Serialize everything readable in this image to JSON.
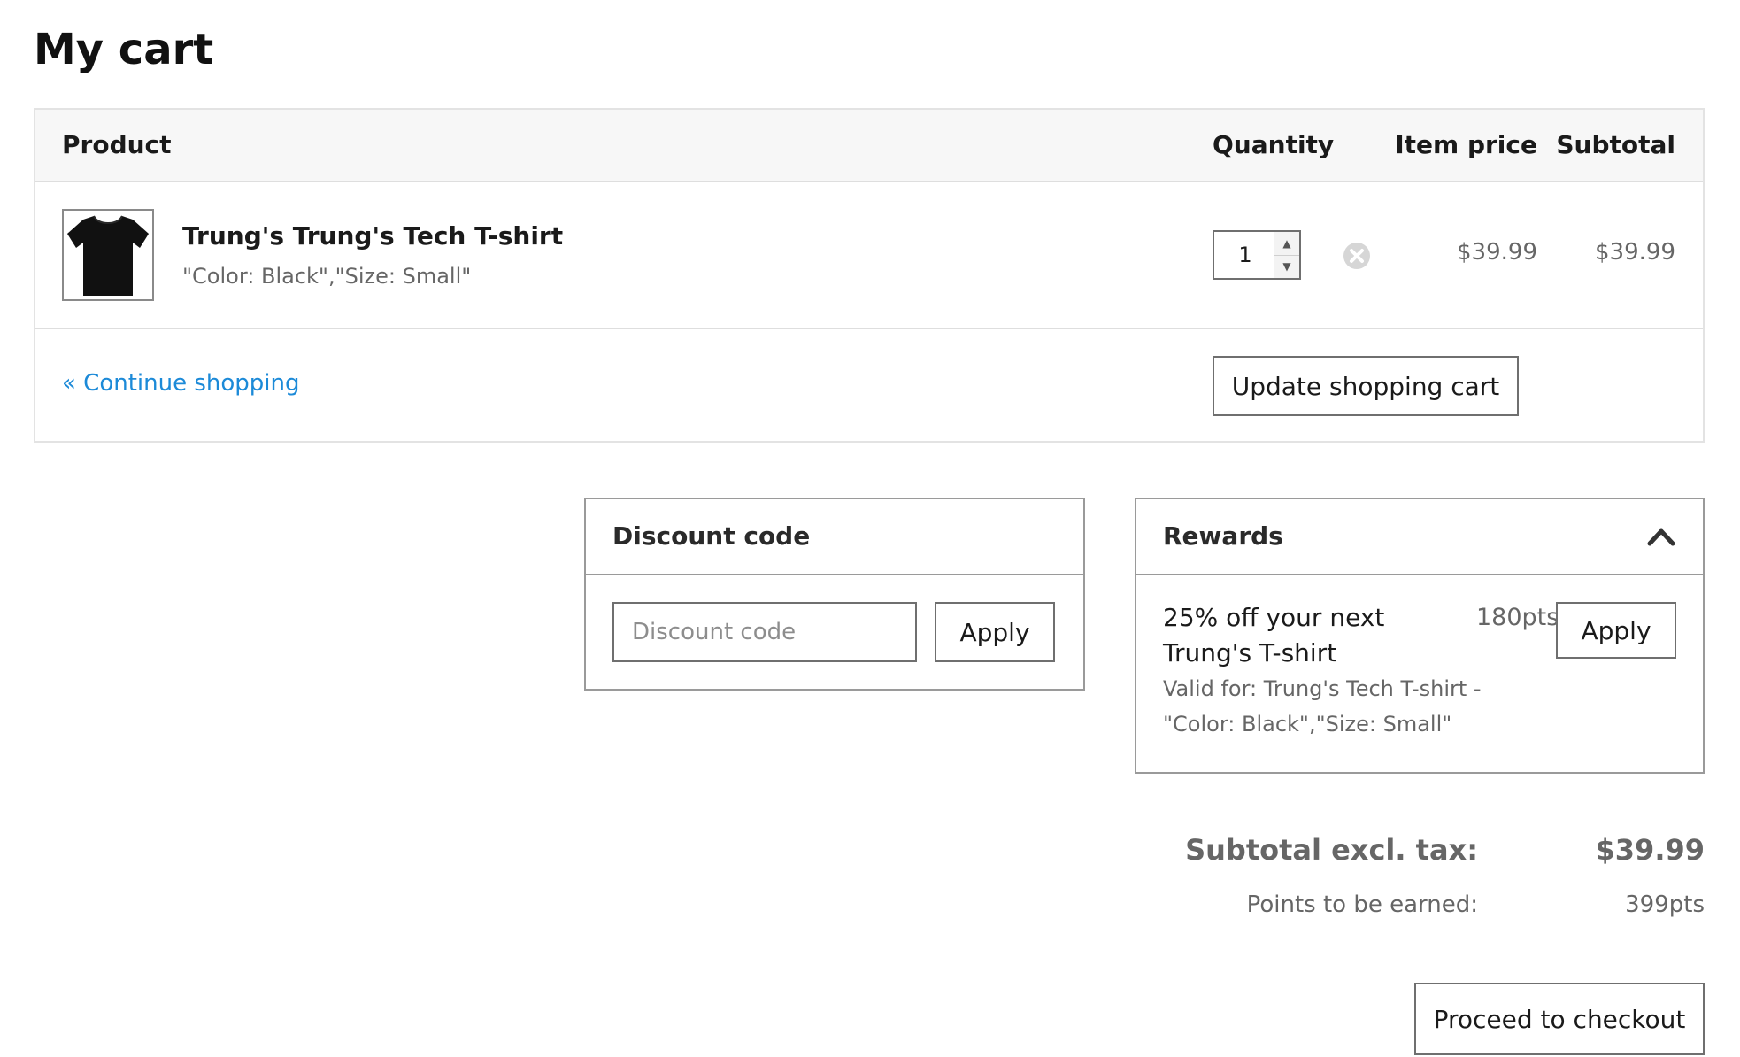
{
  "page": {
    "title": "My cart"
  },
  "cart": {
    "headers": {
      "product": "Product",
      "quantity": "Quantity",
      "item_price": "Item price",
      "subtotal": "Subtotal"
    },
    "items": [
      {
        "name": "Trung's Trung's Tech T-shirt",
        "variant": "\"Color: Black\",\"Size: Small\"",
        "quantity": "1",
        "item_price": "$39.99",
        "subtotal": "$39.99",
        "thumbnail_icon": "black-tshirt-image",
        "remove_icon": "remove-circle-icon"
      }
    ],
    "continue_shopping_label": "« Continue shopping",
    "update_cart_label": "Update shopping cart"
  },
  "discount": {
    "title": "Discount code",
    "placeholder": "Discount code",
    "value": "",
    "apply_label": "Apply"
  },
  "rewards": {
    "title": "Rewards",
    "toggle_icon": "chevron-up-icon",
    "items": [
      {
        "description": "25% off your next Trung's T-shirt",
        "points": "180pts",
        "valid_for": "Valid for: Trung's Tech T-shirt - \"Color: Black\",\"Size: Small\"",
        "apply_label": "Apply"
      }
    ]
  },
  "totals": {
    "subtotal_label": "Subtotal excl. tax:",
    "subtotal_value": "$39.99",
    "points_label": "Points to be earned:",
    "points_value": "399pts"
  },
  "checkout": {
    "label": "Proceed to checkout"
  },
  "colors": {
    "link": "#1c8ad8",
    "border": "#6f6f6f",
    "header_bg": "#f7f7f7",
    "muted_text": "#666666"
  }
}
